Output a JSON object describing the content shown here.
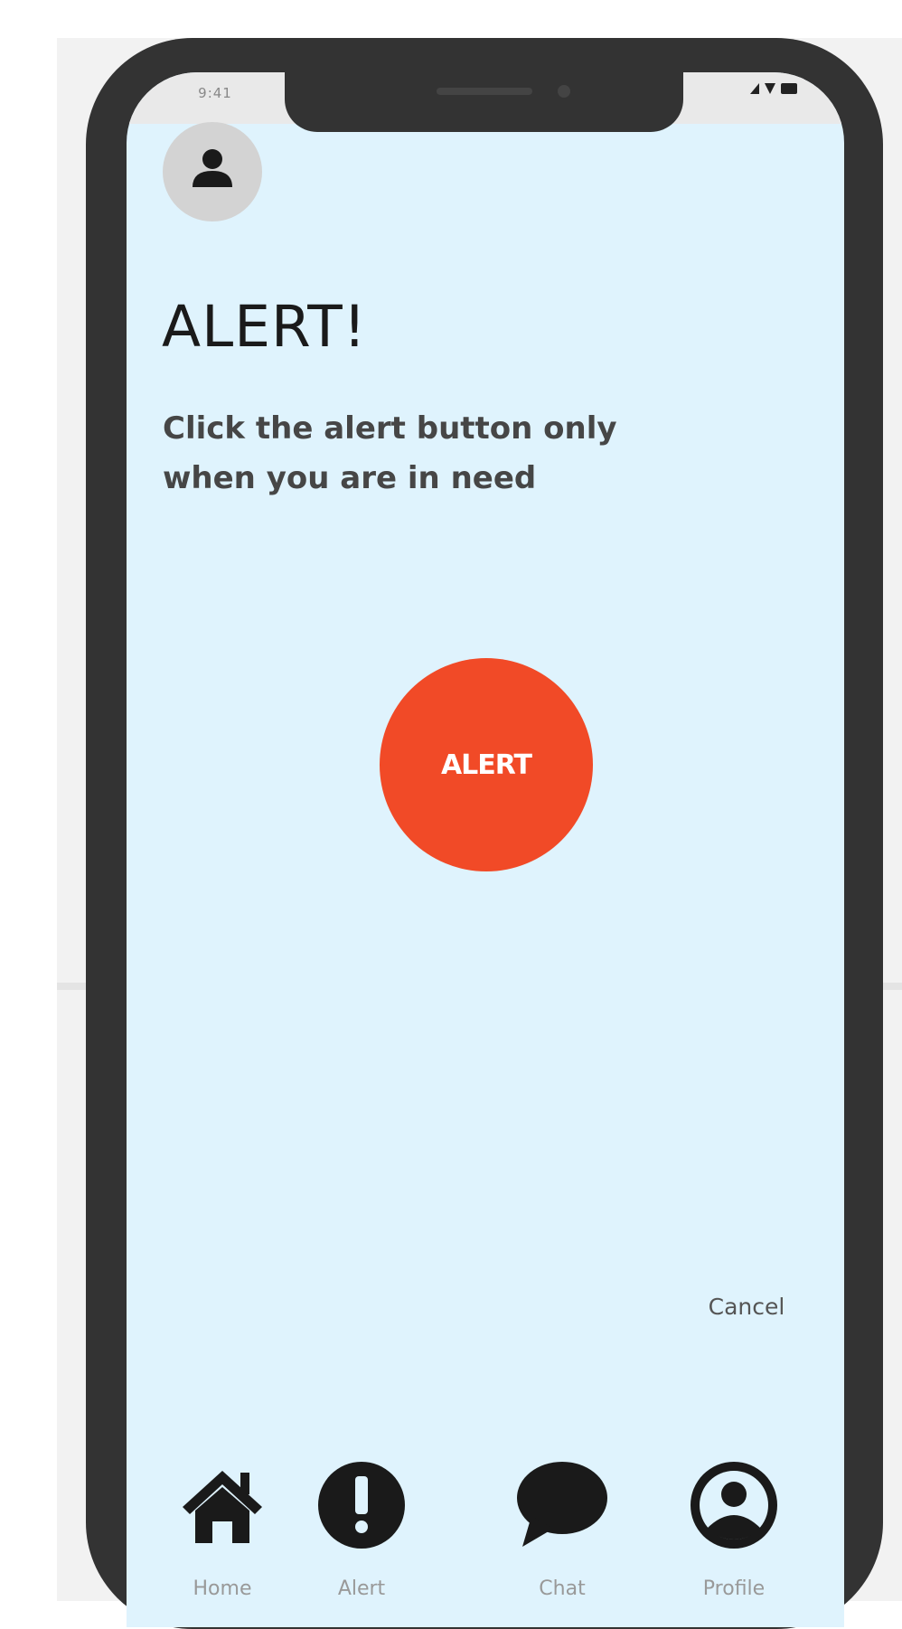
{
  "status_bar": {
    "time": "9:41"
  },
  "page": {
    "title": "ALERT!",
    "instruction": "Click the alert button only when you are in need"
  },
  "alert_button": {
    "label": "ALERT",
    "color": "#f14a27"
  },
  "cancel": {
    "label": "Cancel"
  },
  "bottom_nav": {
    "items": [
      {
        "label": "Home",
        "icon": "home-icon"
      },
      {
        "label": "Alert",
        "icon": "exclamation-icon"
      },
      {
        "label": "Chat",
        "icon": "chat-bubble-icon"
      },
      {
        "label": "Profile",
        "icon": "user-circle-icon"
      }
    ]
  },
  "colors": {
    "screen_background": "#dff3fd",
    "device_frame": "#333333",
    "icon": "#1a1a1a"
  }
}
